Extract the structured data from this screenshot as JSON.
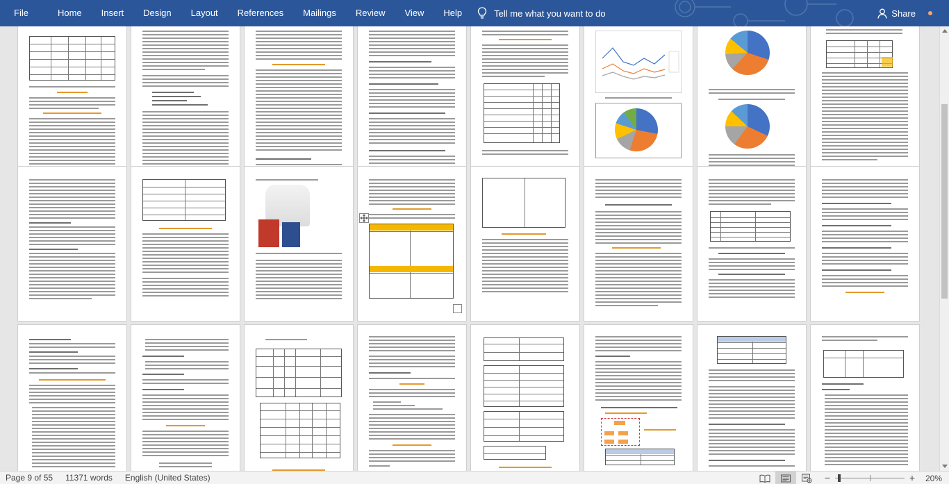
{
  "menu": {
    "file": "File",
    "home": "Home",
    "insert": "Insert",
    "design": "Design",
    "layout": "Layout",
    "references": "References",
    "mailings": "Mailings",
    "review": "Review",
    "view": "View",
    "help": "Help",
    "tell_me": "Tell me what you want to do",
    "share": "Share"
  },
  "status": {
    "page": "Page 9 of 55",
    "words": "11371 words",
    "language": "English (United States)",
    "zoom": "20%",
    "zoom_level": 0.2
  },
  "colors": {
    "ribbon": "#2b579a",
    "status_bg": "#f3f3f3",
    "table_header_orange": "#f5b700",
    "table_header_blue": "#b9cbe6"
  },
  "icons": {
    "tell_me": "lightbulb-icon",
    "share": "person-icon",
    "read_mode": "book-icon",
    "print_layout": "page-icon",
    "web_layout": "web-icon"
  }
}
